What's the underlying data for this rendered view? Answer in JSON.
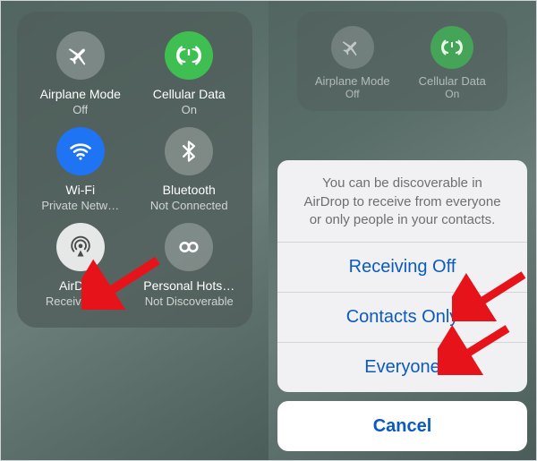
{
  "left": {
    "items": [
      {
        "title": "Airplane Mode",
        "sub": "Off"
      },
      {
        "title": "Cellular Data",
        "sub": "On"
      },
      {
        "title": "Wi-Fi",
        "sub": "Private Netw…"
      },
      {
        "title": "Bluetooth",
        "sub": "Not Connected"
      },
      {
        "title": "AirDrop",
        "sub": "Receiving Off"
      },
      {
        "title": "Personal Hots…",
        "sub": "Not Discoverable"
      }
    ]
  },
  "right": {
    "mini": [
      {
        "title": "Airplane Mode",
        "sub": "Off"
      },
      {
        "title": "Cellular Data",
        "sub": "On"
      }
    ],
    "sheet": {
      "message": "You can be discoverable in AirDrop to receive from everyone or only people in your contacts.",
      "options": [
        "Receiving Off",
        "Contacts Only",
        "Everyone"
      ],
      "cancel": "Cancel"
    }
  }
}
